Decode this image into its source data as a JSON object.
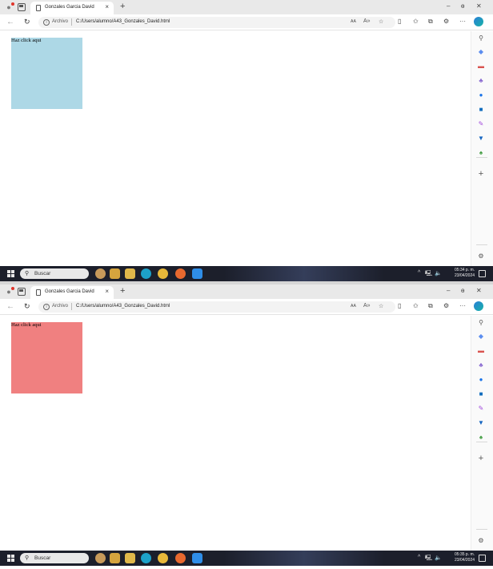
{
  "screens": [
    {
      "browser": {
        "tab_title": "Gonzales Garcia David",
        "tab_close": "×",
        "new_tab": "+",
        "minimize": "–",
        "restore": "ɵ",
        "close": "✕",
        "address_prefix": "Archivo",
        "url": "C:/Users/alumno/A43_Gonzales_David.html"
      },
      "box": {
        "label": "Haz click aqui",
        "color": "#add8e6"
      },
      "taskbar": {
        "search_text": "Buscar",
        "time": "05:34 p. m.",
        "date": "23/04/2024"
      }
    },
    {
      "browser": {
        "tab_title": "Gonzales Garcia David",
        "tab_close": "×",
        "new_tab": "+",
        "minimize": "–",
        "restore": "ɵ",
        "close": "✕",
        "address_prefix": "Archivo",
        "url": "C:/Users/alumno/A43_Gonzales_David.html"
      },
      "box": {
        "label": "Haz click aqui",
        "color": "#f08080"
      },
      "taskbar": {
        "search_text": "Buscar",
        "time": "05:35 p. m.",
        "date": "23/04/2024"
      }
    }
  ],
  "icons": {
    "profile": "profile-icon",
    "tabs": "tab-actions-icon",
    "back": "back-arrow-icon",
    "reload": "reload-icon",
    "info": "info-icon",
    "read_aloud": "read-aloud-icon",
    "favorite": "favorite-star-icon",
    "split": "split-screen-icon",
    "favorites_bar": "favorites-icon",
    "collections": "collections-icon",
    "extensions": "extensions-icon",
    "more": "more-icon"
  }
}
